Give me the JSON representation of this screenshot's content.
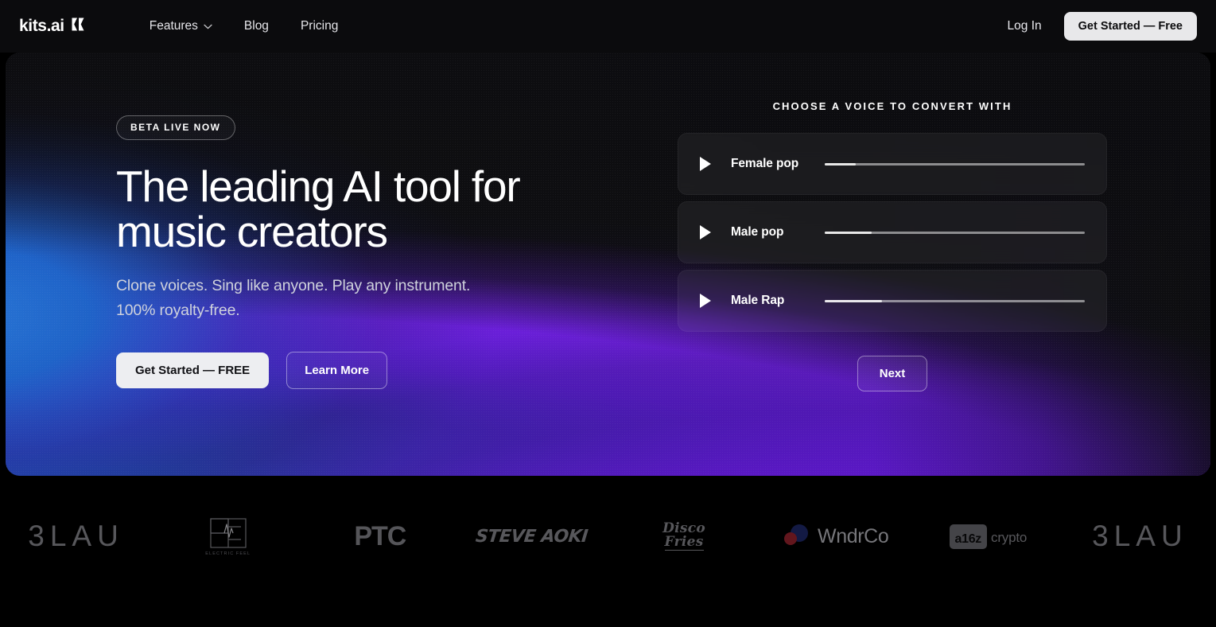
{
  "nav": {
    "logo_text": "kits.ai",
    "logo_mark_name": "kits-logo-mark",
    "links": [
      {
        "label": "Features",
        "has_chevron": true
      },
      {
        "label": "Blog",
        "has_chevron": false
      },
      {
        "label": "Pricing",
        "has_chevron": false
      }
    ],
    "login_label": "Log In",
    "cta_label": "Get Started — Free"
  },
  "hero": {
    "badge": "BETA LIVE NOW",
    "title_line1": "The leading AI tool for",
    "title_line2": "music creators",
    "subtitle_line1": "Clone voices. Sing like anyone. Play any instrument.",
    "subtitle_line2": "100% royalty-free.",
    "primary_cta": "Get Started — FREE",
    "secondary_cta": "Learn More"
  },
  "voice_picker": {
    "heading": "CHOOSE A VOICE TO CONVERT WITH",
    "voices": [
      {
        "label": "Female pop",
        "progress": 12
      },
      {
        "label": "Male pop",
        "progress": 18
      },
      {
        "label": "Male Rap",
        "progress": 22
      }
    ],
    "next_label": "Next"
  },
  "logo_strip": {
    "logos": [
      {
        "name": "3lau-logo",
        "text": "3LAU"
      },
      {
        "name": "electric-feel-logo",
        "text": "ELECTRIC FEEL",
        "mark": "EF"
      },
      {
        "name": "ptc-logo",
        "text": "PTC"
      },
      {
        "name": "steve-aoki-logo",
        "text": "STEVE AOKI"
      },
      {
        "name": "disco-fries-logo",
        "text_line1": "Disco",
        "text_line2": "Fries"
      },
      {
        "name": "wndrco-logo",
        "text": "WndrCo"
      },
      {
        "name": "a16z-crypto-logo",
        "text": "a16z",
        "text2": "crypto"
      },
      {
        "name": "3lau-logo-repeat",
        "text": "3LAU"
      }
    ]
  },
  "colors": {
    "page_background": "#000000",
    "nav_background": "#0b0b0d",
    "hero_blue": "#1f6fd0",
    "hero_purple": "#6a1fd8",
    "cta_light": "#e8e8ea",
    "text_primary": "#ffffff",
    "text_muted": "#cfd2dc",
    "wndrco_navy": "#1f2a6e",
    "wndrco_red": "#9e2430"
  }
}
